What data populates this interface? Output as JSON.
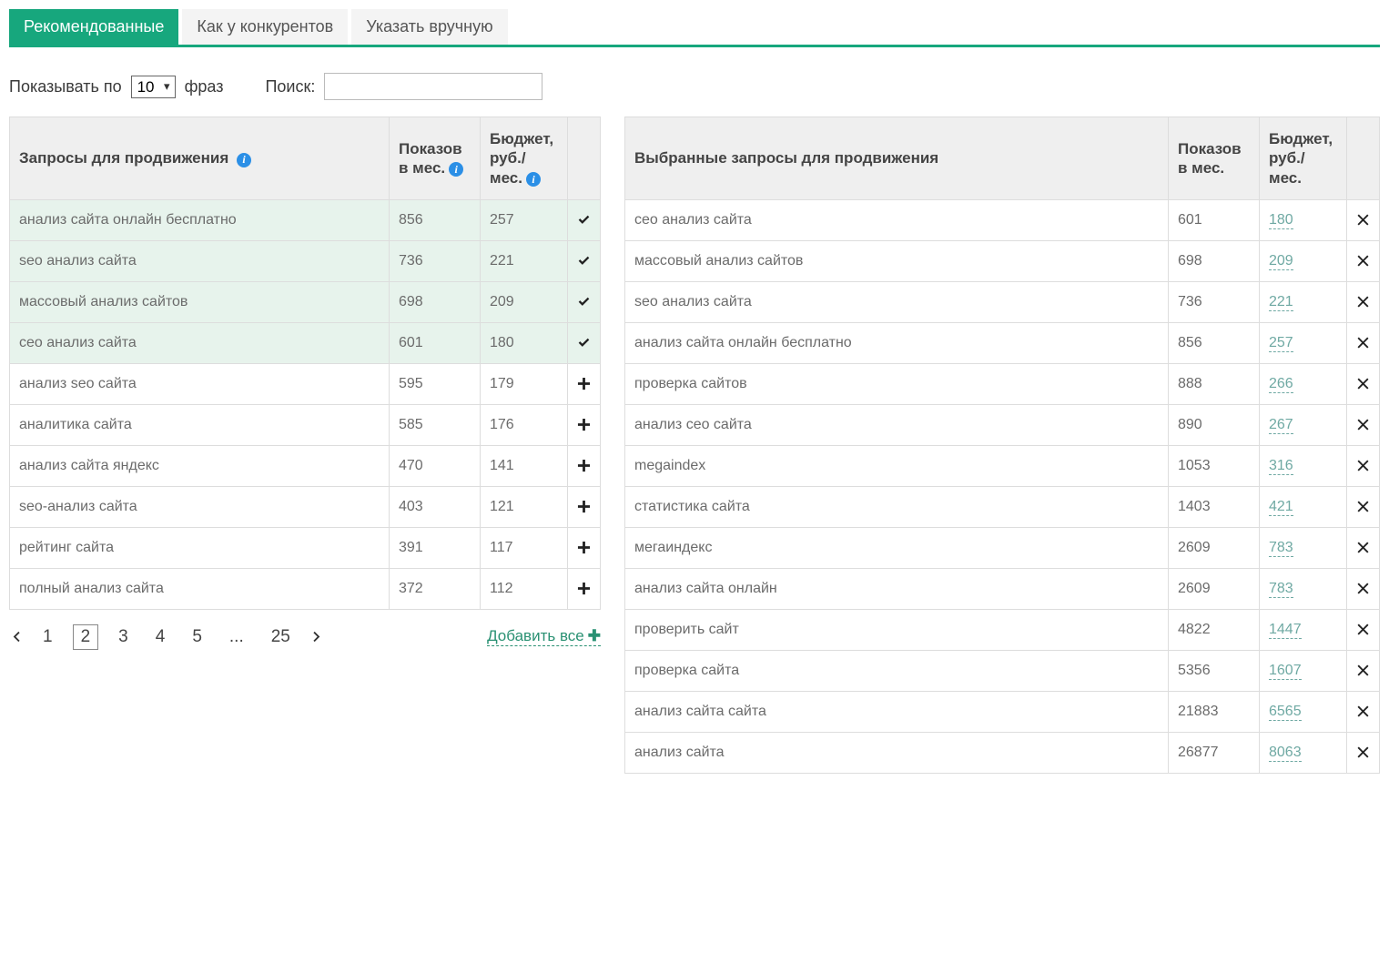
{
  "tabs": [
    {
      "label": "Рекомендованные",
      "active": true
    },
    {
      "label": "Как у конкурентов",
      "active": false
    },
    {
      "label": "Указать вручную",
      "active": false
    }
  ],
  "controls": {
    "show_prefix": "Показывать по",
    "page_size": "10",
    "show_suffix": "фраз",
    "search_label": "Поиск:",
    "search_value": ""
  },
  "left_table": {
    "headers": {
      "query": "Запросы для продвижения",
      "impressions": "Показов в мес.",
      "budget": "Бюджет, руб./ мес."
    },
    "rows": [
      {
        "query": "анализ сайта онлайн бесплатно",
        "impressions": "856",
        "budget": "257",
        "selected": true
      },
      {
        "query": "seo анализ сайта",
        "impressions": "736",
        "budget": "221",
        "selected": true
      },
      {
        "query": "массовый анализ сайтов",
        "impressions": "698",
        "budget": "209",
        "selected": true
      },
      {
        "query": "сео анализ сайта",
        "impressions": "601",
        "budget": "180",
        "selected": true
      },
      {
        "query": "анализ seo сайта",
        "impressions": "595",
        "budget": "179",
        "selected": false
      },
      {
        "query": "аналитика сайта",
        "impressions": "585",
        "budget": "176",
        "selected": false
      },
      {
        "query": "анализ сайта яндекс",
        "impressions": "470",
        "budget": "141",
        "selected": false
      },
      {
        "query": "seo-анализ сайта",
        "impressions": "403",
        "budget": "121",
        "selected": false
      },
      {
        "query": "рейтинг сайта",
        "impressions": "391",
        "budget": "117",
        "selected": false
      },
      {
        "query": "полный анализ сайта",
        "impressions": "372",
        "budget": "112",
        "selected": false
      }
    ]
  },
  "right_table": {
    "headers": {
      "query": "Выбранные запросы для продвижения",
      "impressions": "Показов в мес.",
      "budget": "Бюджет, руб./ мес."
    },
    "rows": [
      {
        "query": "сео анализ сайта",
        "impressions": "601",
        "budget": "180"
      },
      {
        "query": "массовый анализ сайтов",
        "impressions": "698",
        "budget": "209"
      },
      {
        "query": "seo анализ сайта",
        "impressions": "736",
        "budget": "221"
      },
      {
        "query": "анализ сайта онлайн бесплатно",
        "impressions": "856",
        "budget": "257"
      },
      {
        "query": "проверка сайтов",
        "impressions": "888",
        "budget": "266"
      },
      {
        "query": "анализ сео сайта",
        "impressions": "890",
        "budget": "267"
      },
      {
        "query": "megaindex",
        "impressions": "1053",
        "budget": "316"
      },
      {
        "query": "статистика сайта",
        "impressions": "1403",
        "budget": "421"
      },
      {
        "query": "мегаиндекс",
        "impressions": "2609",
        "budget": "783"
      },
      {
        "query": "анализ сайта онлайн",
        "impressions": "2609",
        "budget": "783"
      },
      {
        "query": "проверить сайт",
        "impressions": "4822",
        "budget": "1447"
      },
      {
        "query": "проверка сайта",
        "impressions": "5356",
        "budget": "1607"
      },
      {
        "query": "анализ сайта сайта",
        "impressions": "21883",
        "budget": "6565"
      },
      {
        "query": "анализ сайта",
        "impressions": "26877",
        "budget": "8063"
      }
    ]
  },
  "pagination": {
    "pages": [
      "1",
      "2",
      "3",
      "4",
      "5",
      "...",
      "25"
    ],
    "current": "2"
  },
  "add_all_label": "Добавить все"
}
